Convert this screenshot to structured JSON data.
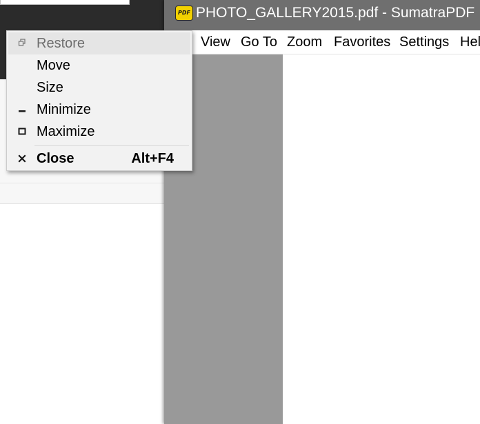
{
  "window": {
    "title": "PHOTO_GALLERY2015.pdf - SumatraPDF",
    "icon": "sumatra-pdf-icon",
    "icon_text": "PDF"
  },
  "menubar": {
    "items": [
      {
        "label": "View"
      },
      {
        "label": "Go To"
      },
      {
        "label": "Zoom"
      },
      {
        "label": "Favorites"
      },
      {
        "label": "Settings"
      },
      {
        "label": "Hel"
      }
    ]
  },
  "system_menu": {
    "items": [
      {
        "label": "Restore",
        "icon": "restore-icon",
        "enabled": false,
        "highlighted": true
      },
      {
        "label": "Move",
        "enabled": true
      },
      {
        "label": "Size",
        "enabled": true
      },
      {
        "label": "Minimize",
        "icon": "minimize-icon",
        "enabled": true
      },
      {
        "label": "Maximize",
        "icon": "maximize-icon",
        "enabled": true
      },
      {
        "label": "Close",
        "icon": "close-icon",
        "accelerator": "Alt+F4",
        "enabled": true,
        "bold": true
      }
    ]
  },
  "colors": {
    "titlebar": "#6f6f6f",
    "document_background": "#999999",
    "menu_background": "#f2f2f2",
    "menu_highlight": "#e5e5e5",
    "icon_yellow": "#f2d100"
  }
}
